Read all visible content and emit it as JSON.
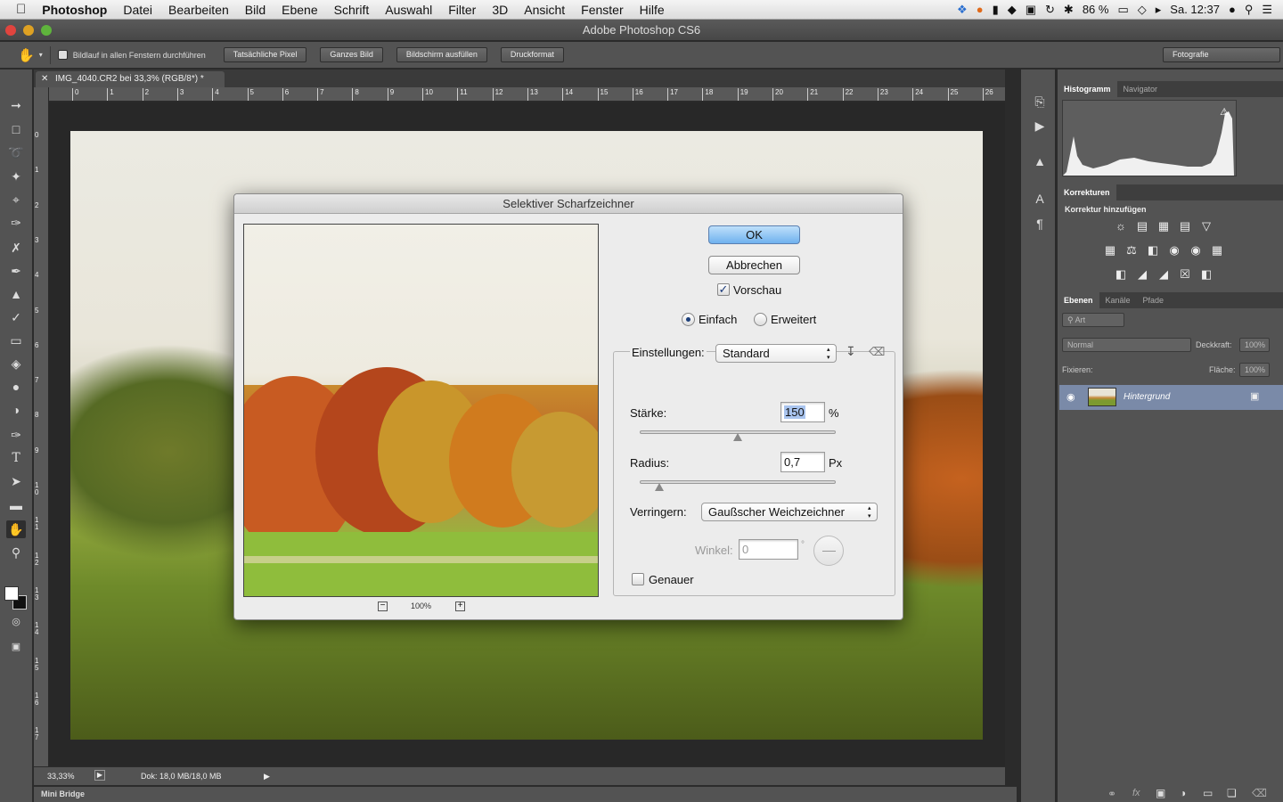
{
  "menubar": {
    "apple": "",
    "items": [
      "Photoshop",
      "Datei",
      "Bearbeiten",
      "Bild",
      "Ebene",
      "Schrift",
      "Auswahl",
      "Filter",
      "3D",
      "Ansicht",
      "Fenster",
      "Hilfe"
    ],
    "battery": "86 %",
    "clock": "Sa. 12:37"
  },
  "window_title": "Adobe Photoshop CS6",
  "optionsbar": {
    "scroll_all_label": "Bildlauf in allen Fenstern durchführen",
    "buttons": [
      "Tatsächliche Pixel",
      "Ganzes Bild",
      "Bildschirm ausfüllen",
      "Druckformat"
    ],
    "workspace": "Fotografie"
  },
  "document": {
    "tab_title": "IMG_4040.CR2 bei 33,3% (RGB/8*) *",
    "ruler_h": [
      "0",
      "1",
      "2",
      "3",
      "4",
      "5",
      "6",
      "7",
      "8",
      "9",
      "10",
      "11",
      "12",
      "13",
      "14",
      "15",
      "16",
      "17",
      "18",
      "19",
      "20",
      "21",
      "22",
      "23",
      "24",
      "25",
      "26"
    ],
    "ruler_v": [
      "0",
      "1",
      "2",
      "3",
      "4",
      "5",
      "6",
      "7",
      "8",
      "9",
      "1 0",
      "1 1",
      "1 2",
      "1 3",
      "1 4",
      "1 5",
      "1 6",
      "1 7"
    ],
    "zoom": "33,33%",
    "doc_size": "Dok: 18,0 MB/18,0 MB"
  },
  "minibridge_label": "Mini Bridge",
  "panels": {
    "histogram_tabs": [
      "Histogramm",
      "Navigator"
    ],
    "adjustments_tab": "Korrekturen",
    "adjustments_heading": "Korrektur hinzufügen",
    "layers_tabs": [
      "Ebenen",
      "Kanäle",
      "Pfade"
    ],
    "filter_kind": "Art",
    "blend_mode": "Normal",
    "opacity_label": "Deckkraft:",
    "opacity_value": "100%",
    "lock_label": "Fixieren:",
    "fill_label": "Fläche:",
    "fill_value": "100%",
    "layer_name": "Hintergrund"
  },
  "dialog": {
    "title": "Selektiver Scharfzeichner",
    "ok": "OK",
    "cancel": "Abbrechen",
    "preview_label": "Vorschau",
    "preview_checked": true,
    "mode_simple": "Einfach",
    "mode_advanced": "Erweitert",
    "selected_mode": "Einfach",
    "settings_label": "Einstellungen:",
    "settings_value": "Standard",
    "amount_label": "Stärke:",
    "amount_value": "150",
    "amount_unit": "%",
    "amount_fraction": 0.5,
    "radius_label": "Radius:",
    "radius_value": "0,7",
    "radius_unit": "Px",
    "radius_fraction": 0.1,
    "remove_label": "Verringern:",
    "remove_value": "Gaußscher Weichzeichner",
    "angle_label": "Winkel:",
    "angle_value": "0",
    "angle_unit": "°",
    "more_accurate_label": "Genauer",
    "more_accurate_checked": false,
    "preview_zoom": "100%"
  }
}
